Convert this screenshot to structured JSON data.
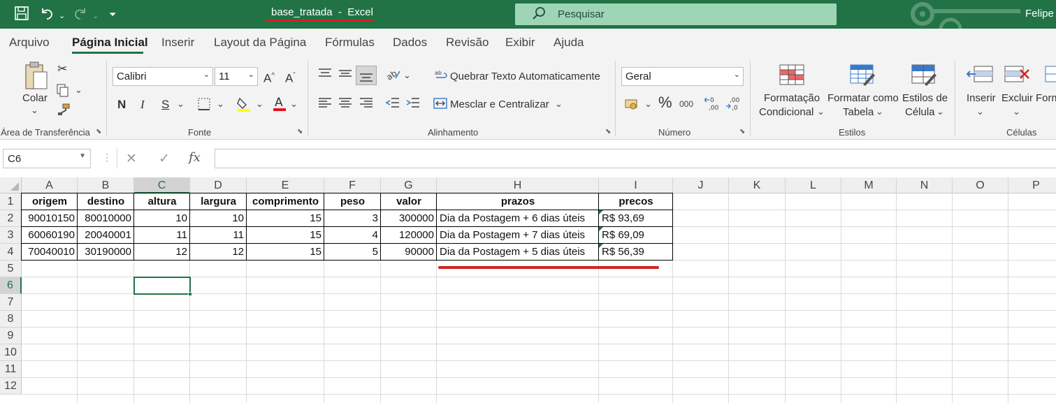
{
  "titlebar": {
    "title": "base_tratada  -  Excel",
    "search_placeholder": "Pesquisar",
    "user": "Felipe",
    "colors": {
      "bar": "#217346",
      "annotation": "#d42121"
    }
  },
  "menu": [
    "Arquivo",
    "Página Inicial",
    "Inserir",
    "Layout da Página",
    "Fórmulas",
    "Dados",
    "Revisão",
    "Exibir",
    "Ajuda"
  ],
  "ribbon": {
    "clipboard": {
      "paste": "Colar",
      "label": "Área de Transferência"
    },
    "font": {
      "name": "Calibri",
      "size": "11",
      "bold": "N",
      "italic": "I",
      "underline": "S",
      "label": "Fonte"
    },
    "alignment": {
      "wrap": "Quebrar Texto Automaticamente",
      "merge": "Mesclar e Centralizar",
      "label": "Alinhamento"
    },
    "number": {
      "format": "Geral",
      "label": "Número"
    },
    "styles": {
      "conditional_1": "Formatação",
      "conditional_2": "Condicional",
      "table_1": "Formatar como",
      "table_2": "Tabela",
      "cell_1": "Estilos de",
      "cell_2": "Célula",
      "label": "Estilos"
    },
    "cells": {
      "insert": "Inserir",
      "delete": "Excluir",
      "format": "Form",
      "label": "Células"
    }
  },
  "formula_bar": {
    "name_box": "C6",
    "content": ""
  },
  "sheet": {
    "columns": [
      "A",
      "B",
      "C",
      "D",
      "E",
      "F",
      "G",
      "H",
      "I",
      "J",
      "K",
      "L",
      "M",
      "N",
      "O",
      "P"
    ],
    "rows": [
      "1",
      "2",
      "3",
      "4",
      "5",
      "6",
      "7",
      "8",
      "9",
      "10",
      "11",
      "12"
    ],
    "selected_cell": "C6",
    "headers": [
      "origem",
      "destino",
      "altura",
      "largura",
      "comprimento",
      "peso",
      "valor",
      "prazos",
      "precos"
    ],
    "data": [
      [
        "90010150",
        "80010000",
        "10",
        "10",
        "15",
        "3",
        "300000",
        "Dia da Postagem + 6 dias úteis",
        "R$ 93,69"
      ],
      [
        "60060190",
        "20040001",
        "11",
        "11",
        "15",
        "4",
        "120000",
        "Dia da Postagem + 7 dias úteis",
        "R$ 69,09"
      ],
      [
        "70040010",
        "30190000",
        "12",
        "12",
        "15",
        "5",
        "90000",
        "Dia da Postagem + 5 dias úteis",
        "R$ 56,39"
      ]
    ]
  }
}
